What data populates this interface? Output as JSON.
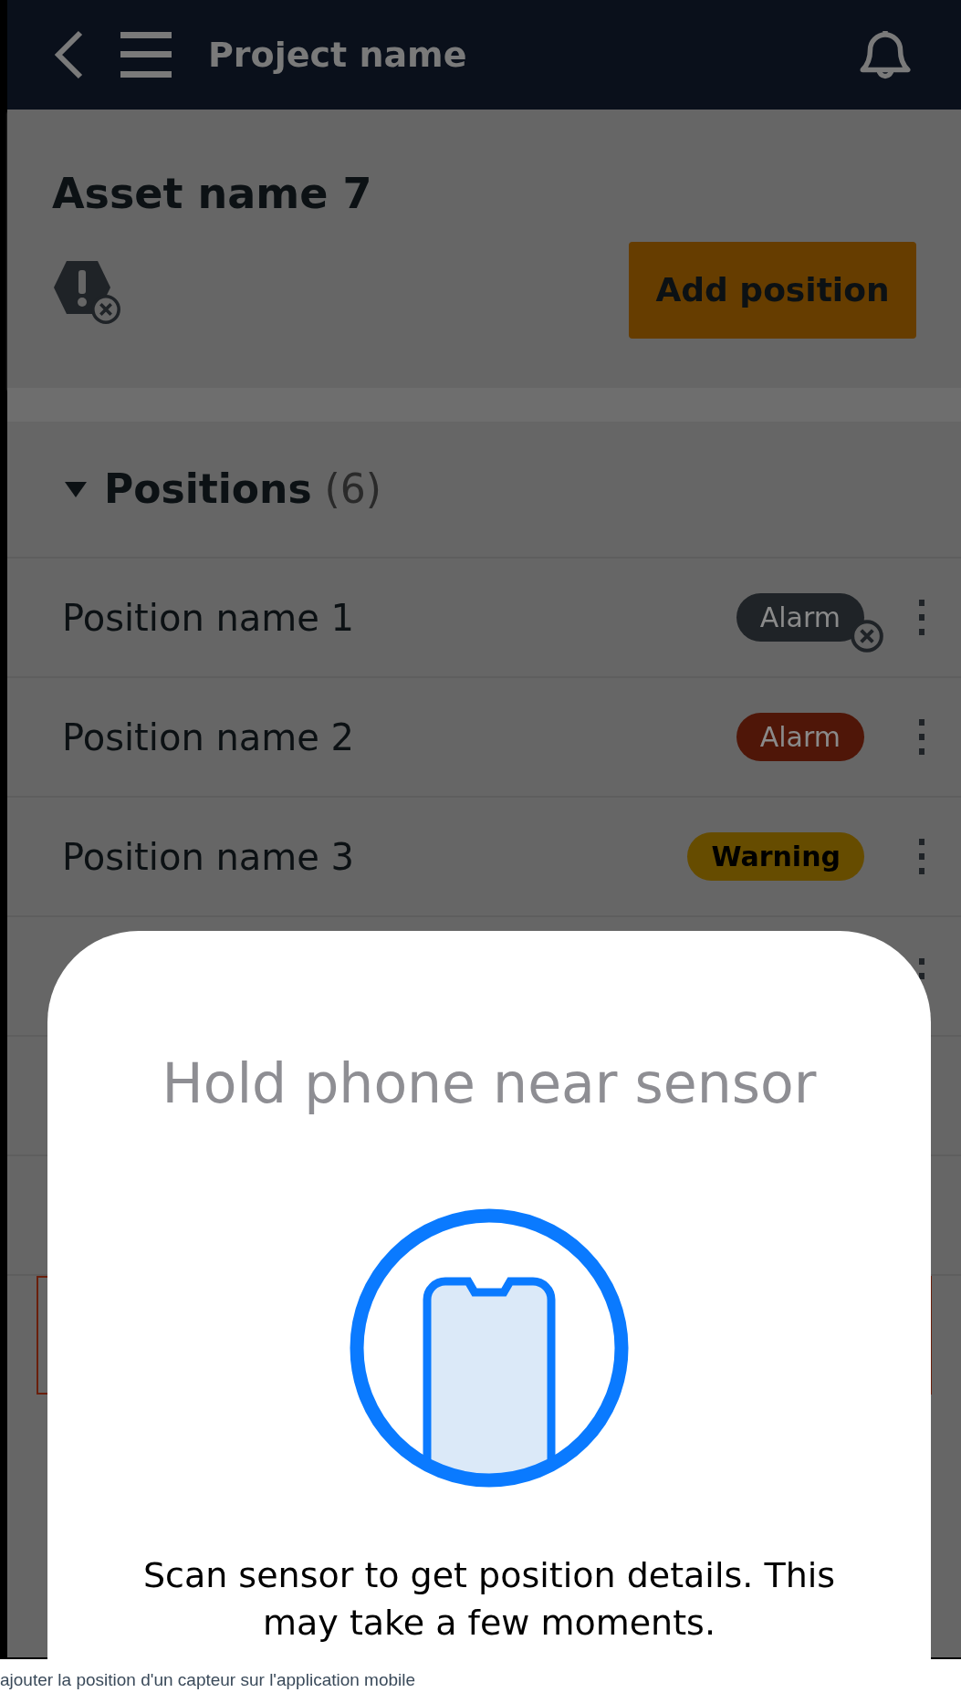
{
  "header": {
    "title": "Project name"
  },
  "asset": {
    "title": "Asset name 7",
    "button": "Add position"
  },
  "positions": {
    "title": "Positions",
    "count": "(6)",
    "expanded": true,
    "rows": [
      {
        "name": "Position name 1",
        "badge": {
          "label": "Alarm",
          "kind": "offline"
        }
      },
      {
        "name": "Position name 2",
        "badge": {
          "label": "Alarm",
          "kind": "alarm"
        }
      },
      {
        "name": "Position name 3",
        "badge": {
          "label": "Warning",
          "kind": "warning"
        }
      }
    ]
  },
  "modal": {
    "title": "Hold phone near sensor",
    "description": "Scan sensor to get position details. This may take a few moments."
  },
  "caption": "ajouter la position d'un capteur sur l'application mobile"
}
